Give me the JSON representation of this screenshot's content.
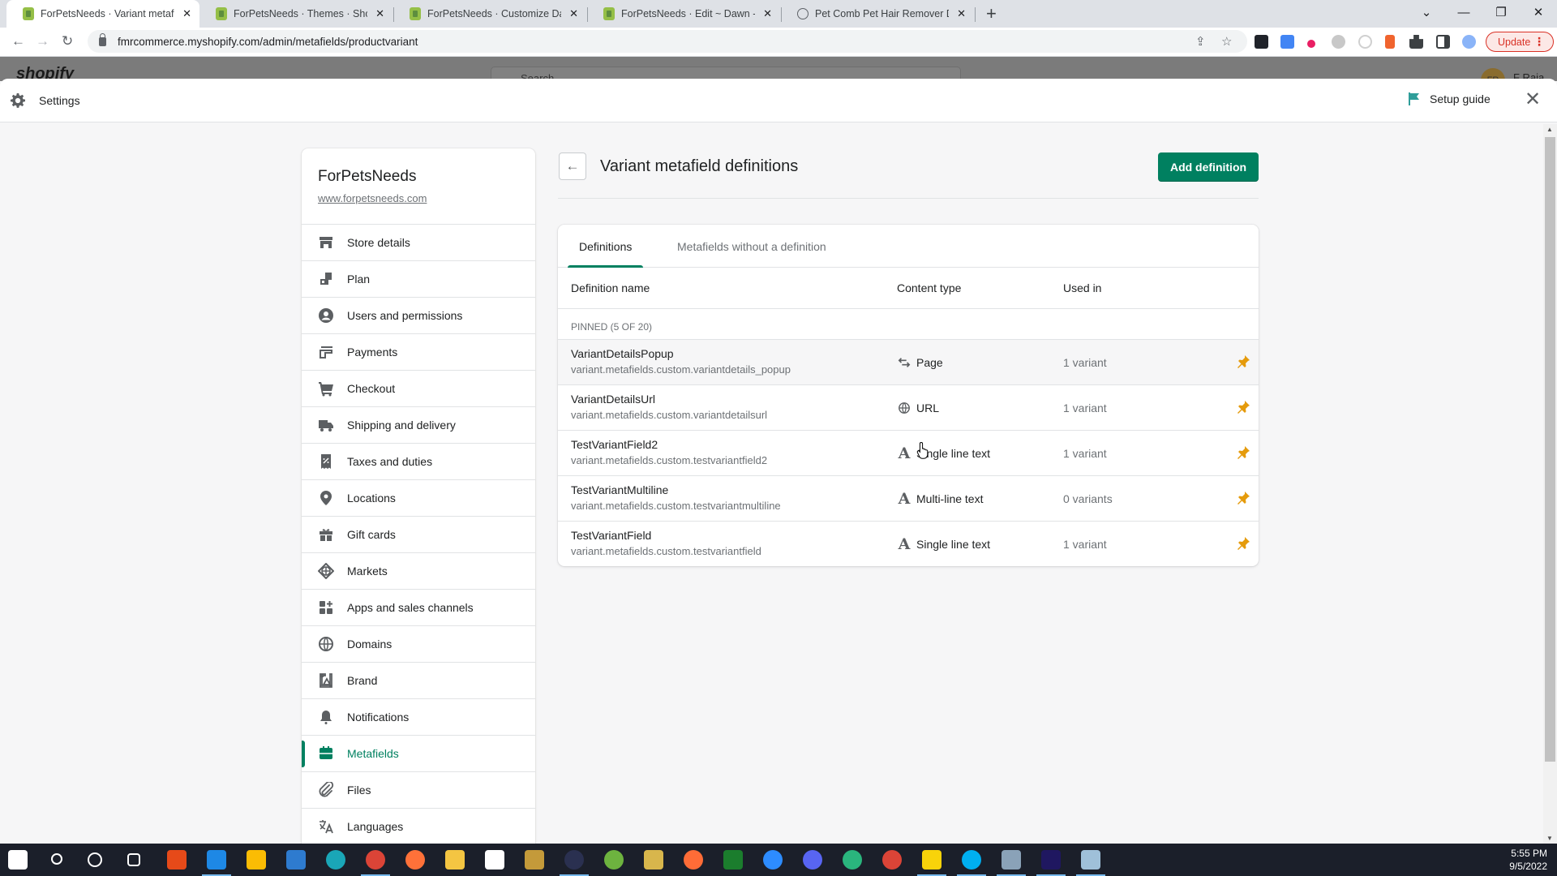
{
  "browser": {
    "tabs": [
      {
        "title": "ForPetsNeeds · Variant metafield",
        "active": true,
        "favicon": "shopify-icon"
      },
      {
        "title": "ForPetsNeeds · Themes · Shopify",
        "active": false,
        "favicon": "shopify-icon"
      },
      {
        "title": "ForPetsNeeds · Customize Dawn",
        "active": false,
        "favicon": "shopify-icon"
      },
      {
        "title": "ForPetsNeeds · Edit ~ Dawn - Pro",
        "active": false,
        "favicon": "shopify-icon"
      },
      {
        "title": "Pet Comb Pet Hair Remover Dog",
        "active": false,
        "favicon": "globe-icon"
      }
    ],
    "tab_close": "✕",
    "new_tab": "+",
    "url": "fmrcommerce.myshopify.com/admin/metafields/productvariant",
    "update_label": "Update",
    "window_controls": {
      "dropdown": "⌄",
      "minimize": "—",
      "restore": "❐",
      "close": "✕"
    }
  },
  "shopify_bar": {
    "logo": "shopify",
    "search_placeholder": "Search",
    "avatar_initials": "FR",
    "user_name": "F Raja"
  },
  "settings": {
    "title": "Settings",
    "setup_guide": "Setup guide",
    "close": "✕",
    "accent_color": "#008060"
  },
  "sidebar": {
    "store_name": "ForPetsNeeds",
    "store_url": "www.forpetsneeds.com",
    "items": [
      {
        "label": "Store details",
        "icon": "store-icon"
      },
      {
        "label": "Plan",
        "icon": "plan-icon"
      },
      {
        "label": "Users and permissions",
        "icon": "user-icon"
      },
      {
        "label": "Payments",
        "icon": "payments-icon"
      },
      {
        "label": "Checkout",
        "icon": "cart-icon"
      },
      {
        "label": "Shipping and delivery",
        "icon": "truck-icon"
      },
      {
        "label": "Taxes and duties",
        "icon": "tax-icon"
      },
      {
        "label": "Locations",
        "icon": "location-pin-icon"
      },
      {
        "label": "Gift cards",
        "icon": "gift-icon"
      },
      {
        "label": "Markets",
        "icon": "markets-globe-icon"
      },
      {
        "label": "Apps and sales channels",
        "icon": "apps-icon"
      },
      {
        "label": "Domains",
        "icon": "domains-globe-icon"
      },
      {
        "label": "Brand",
        "icon": "brand-icon"
      },
      {
        "label": "Notifications",
        "icon": "bell-icon"
      },
      {
        "label": "Metafields",
        "icon": "metafields-icon",
        "active": true
      },
      {
        "label": "Files",
        "icon": "paperclip-icon"
      },
      {
        "label": "Languages",
        "icon": "translate-icon"
      }
    ]
  },
  "main": {
    "back": "←",
    "title": "Variant metafield definitions",
    "add_button": "Add definition",
    "tabs": [
      {
        "label": "Definitions",
        "active": true
      },
      {
        "label": "Metafields without a definition",
        "active": false
      }
    ],
    "columns": [
      "Definition name",
      "Content type",
      "Used in"
    ],
    "pinned_label": "PINNED (5 OF 20)",
    "rows": [
      {
        "name": "VariantDetailsPopup",
        "key": "variant.metafields.custom.variantdetails_popup",
        "content_type": "Page",
        "type_icon": "reference-arrows-icon",
        "used_in": "1 variant",
        "pinned": true
      },
      {
        "name": "VariantDetailsUrl",
        "key": "variant.metafields.custom.variantdetailsurl",
        "content_type": "URL",
        "type_icon": "globe-icon",
        "used_in": "1 variant",
        "pinned": true
      },
      {
        "name": "TestVariantField2",
        "key": "variant.metafields.custom.testvariantfield2",
        "content_type": "Single line text",
        "type_icon": "text-a-icon",
        "used_in": "1 variant",
        "pinned": true
      },
      {
        "name": "TestVariantMultiline",
        "key": "variant.metafields.custom.testvariantmultiline",
        "content_type": "Multi-line text",
        "type_icon": "text-a-icon",
        "used_in": "0 variants",
        "pinned": true
      },
      {
        "name": "TestVariantField",
        "key": "variant.metafields.custom.testvariantfield",
        "content_type": "Single line text",
        "type_icon": "text-a-icon",
        "used_in": "1 variant",
        "pinned": true
      }
    ],
    "pin_color": "#e59b0c"
  },
  "taskbar": {
    "time": "5:55 PM",
    "date": "9/5/2022",
    "apps": [
      "windows-start",
      "search",
      "cortana",
      "task-view",
      "screen-recorder",
      "vscode",
      "google-ads",
      "mail",
      "edge",
      "chrome",
      "firefox",
      "file-explorer",
      "ms-store",
      "game",
      "obs",
      "spring",
      "tools",
      "postman",
      "grid-app",
      "zoom",
      "discord",
      "kite",
      "chrome-2",
      "sticky-notes",
      "skype",
      "calculator",
      "premiere-pro",
      "notepad"
    ]
  }
}
